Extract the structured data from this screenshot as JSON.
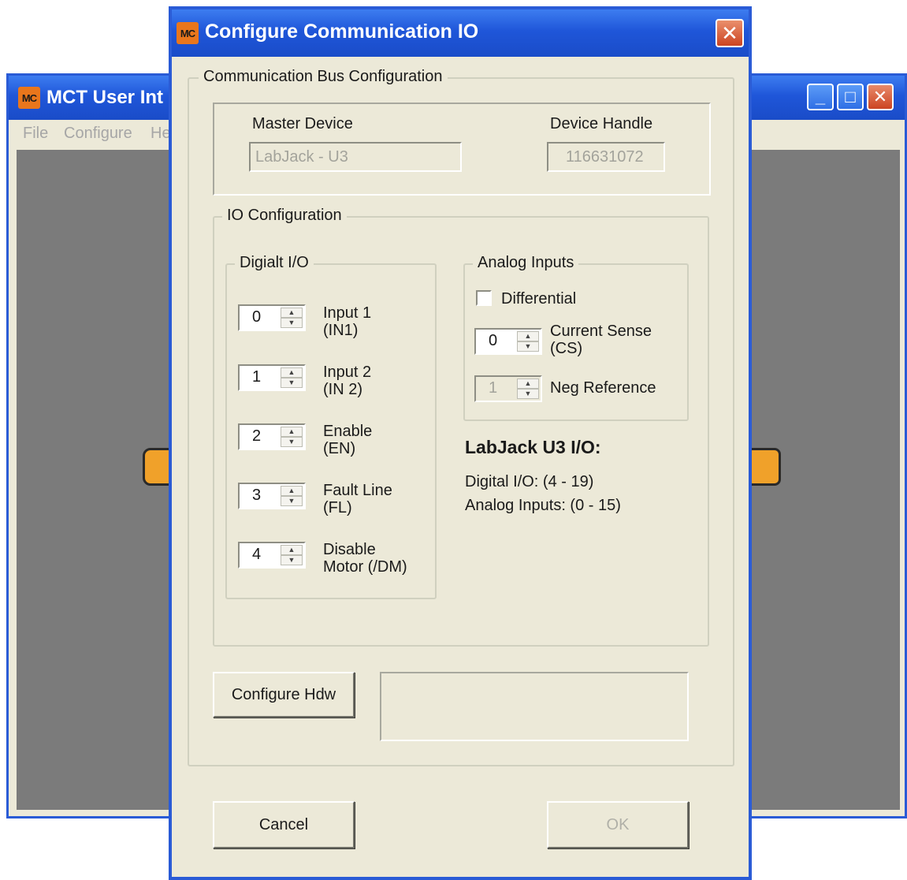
{
  "background_window": {
    "title": "MCT User Int",
    "menu": [
      "File",
      "Configure",
      "He"
    ]
  },
  "dialog": {
    "title": "Configure Communication IO",
    "app_icon_text": "MC",
    "close_symbol": "✕"
  },
  "bus_config": {
    "legend": "Communication Bus Configuration",
    "master_device_label": "Master Device",
    "master_device_value": "LabJack - U3",
    "device_handle_label": "Device Handle",
    "device_handle_value": "116631072"
  },
  "io_config": {
    "legend": "IO Configuration",
    "digital": {
      "legend": "Digialt I/O",
      "items": [
        {
          "value": "0",
          "line1": "Input 1",
          "line2": "(IN1)"
        },
        {
          "value": "1",
          "line1": "Input 2",
          "line2": "(IN 2)"
        },
        {
          "value": "2",
          "line1": "Enable",
          "line2": "(EN)"
        },
        {
          "value": "3",
          "line1": "Fault Line",
          "line2": "(FL)"
        },
        {
          "value": "4",
          "line1": "Disable",
          "line2": "Motor (/DM)"
        }
      ]
    },
    "analog": {
      "legend": "Analog Inputs",
      "differential_label": "Differential",
      "differential_checked": false,
      "current_sense_value": "0",
      "current_sense_line1": "Current Sense",
      "current_sense_line2": "(CS)",
      "neg_reference_value": "1",
      "neg_reference_label": "Neg Reference"
    },
    "info": {
      "heading": "LabJack U3 I/O:",
      "digital_range": "Digital I/O: (4 - 19)",
      "analog_range": "Analog Inputs: (0 - 15)"
    }
  },
  "buttons": {
    "configure_hdw": "Configure Hdw",
    "cancel": "Cancel",
    "ok": "OK"
  },
  "window_controls": {
    "minimize": "_",
    "maximize": "□",
    "close": "✕"
  },
  "colors": {
    "titlebar": "#1f56d9",
    "dialog_face": "#ece9d8",
    "close_button": "#cc4422",
    "app_icon": "#e9761c",
    "logo_orange": "#f0a12a",
    "workspace": "#7b7b7b"
  }
}
